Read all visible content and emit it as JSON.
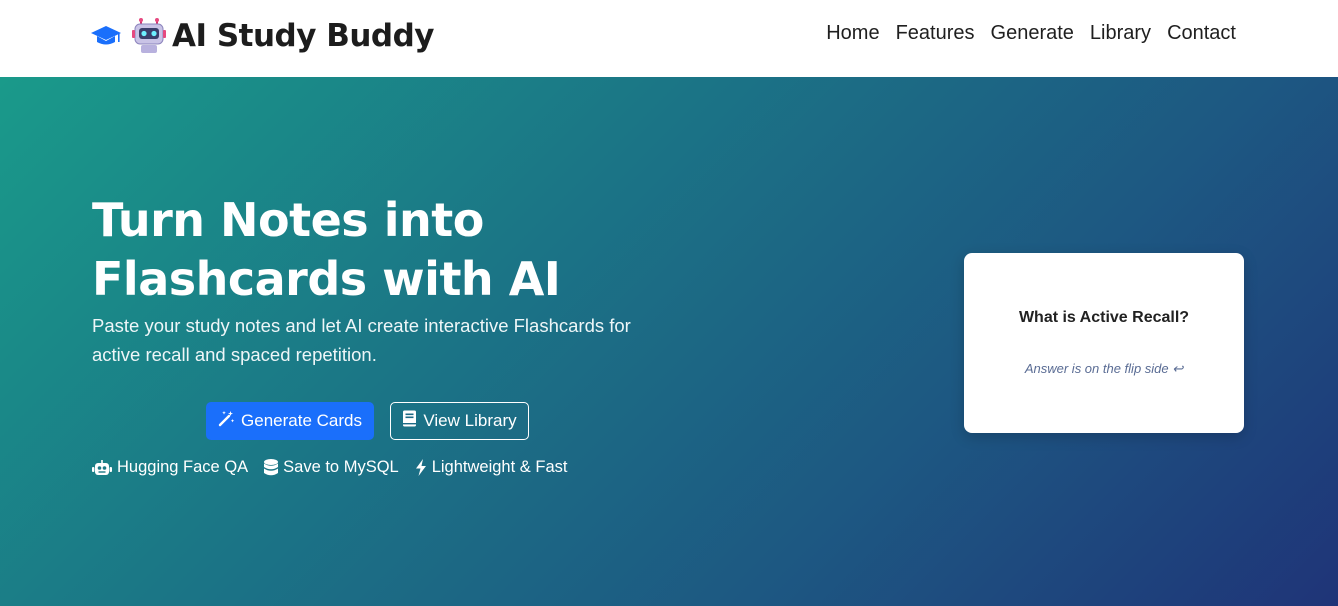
{
  "brand": {
    "title": "AI Study Buddy",
    "icons": [
      "graduation-cap-icon",
      "robot-emoji-icon"
    ]
  },
  "nav": {
    "items": [
      "Home",
      "Features",
      "Generate",
      "Library",
      "Contact"
    ]
  },
  "hero": {
    "title": "Turn Notes into Flashcards with AI",
    "subtitle": "Paste your study notes and let AI create interactive Flashcards for active recall and spaced repetition.",
    "buttons": {
      "generate": "Generate Cards",
      "library": "View Library"
    },
    "features": [
      {
        "label": "Hugging Face QA",
        "icon": "robot-icon"
      },
      {
        "label": "Save to MySQL",
        "icon": "database-icon"
      },
      {
        "label": "Lightweight & Fast",
        "icon": "bolt-icon"
      }
    ]
  },
  "flashcard": {
    "question": "What is Active Recall?",
    "hint": "Answer is on the flip side ↩"
  },
  "colors": {
    "primary": "#1a6ffb",
    "gradient_start": "#1a9a8a",
    "gradient_end": "#1f3478",
    "brand_icon": "#1a6ffb"
  }
}
